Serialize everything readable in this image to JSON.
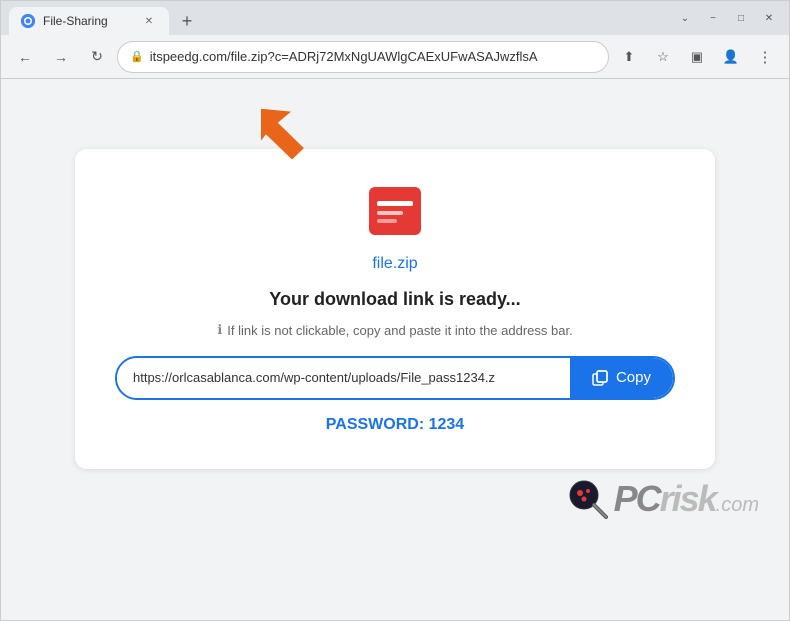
{
  "browser": {
    "tab_title": "File-Sharing",
    "address": "itspeedg.com/file.zip?c=ADRj72MxNgUAWlgCAExUFwASAJwzflsA",
    "address_full": "itspeedg.com/file.zip?c=ADRj72MxNgUAWlgCAExUFwASAJwzflsA",
    "new_tab_label": "+",
    "win_minimize": "−",
    "win_maximize": "□",
    "win_close": "✕"
  },
  "nav": {
    "back": "←",
    "forward": "→",
    "reload": "↻",
    "lock": "🔒"
  },
  "toolbar_right": {
    "share": "⬆",
    "bookmark": "☆",
    "extensions": "□",
    "profile": "👤",
    "menu": "⋮"
  },
  "page": {
    "file_name": "file.zip",
    "headline": "Your download link is ready...",
    "hint_text": "If link is not clickable, copy and paste it into the address bar.",
    "download_link": "https://orlcasablanca.com/wp-content/uploads/File_pass1234.z",
    "copy_button_label": "Copy",
    "password_label": "PASSWORD: 1234"
  },
  "watermark": {
    "pcrisk": "PCrisk.com"
  },
  "colors": {
    "accent": "#1a73e8",
    "text_main": "#222222",
    "text_sub": "#666666",
    "password": "#1a73e8"
  }
}
